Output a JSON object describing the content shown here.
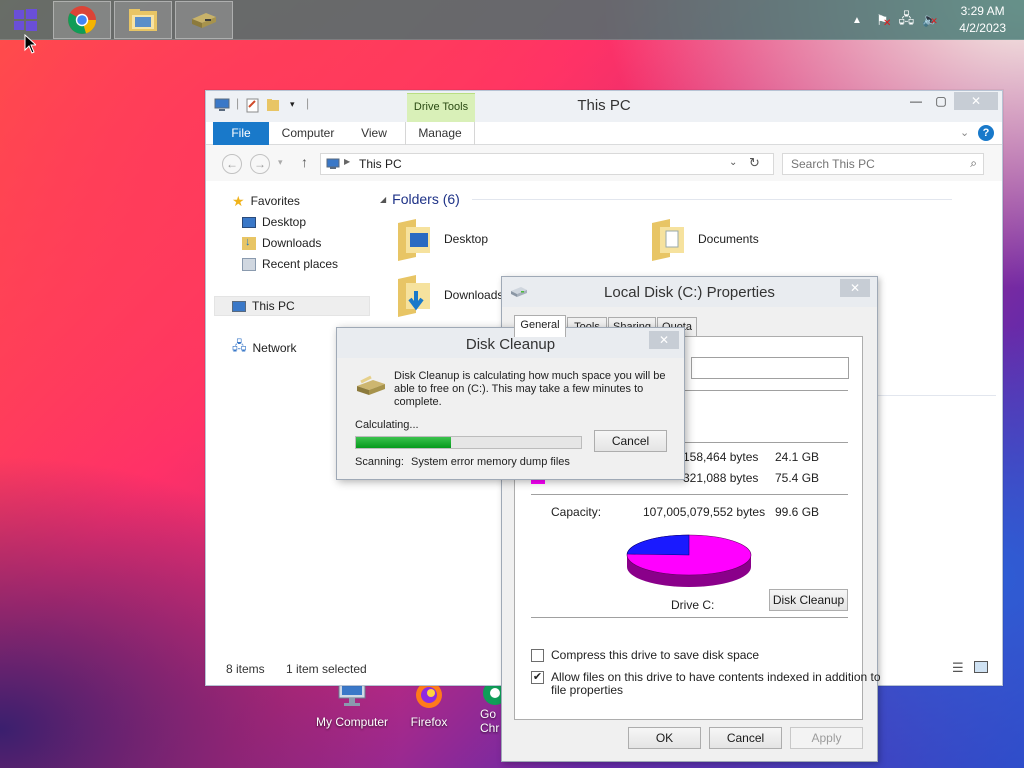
{
  "taskbar": {
    "apps": [
      "start-menu",
      "chrome",
      "file-explorer",
      "disk-drive"
    ],
    "clock": {
      "time": "3:29 AM",
      "date": "4/2/2023"
    }
  },
  "explorer": {
    "title": "This PC",
    "contextual_tab": "Drive Tools",
    "ribbon_tabs": [
      "File",
      "Computer",
      "View",
      "Manage"
    ],
    "address": "This PC",
    "search_placeholder": "Search This PC",
    "nav": {
      "favorites": "Favorites",
      "desktop": "Desktop",
      "downloads": "Downloads",
      "recent": "Recent places",
      "this_pc": "This PC",
      "network": "Network"
    },
    "folders_header": "Folders (6)",
    "folders": [
      "Desktop",
      "Documents",
      "Downloads"
    ],
    "status": {
      "items": "8 items",
      "selected": "1 item selected"
    }
  },
  "properties": {
    "title": "Local Disk (C:) Properties",
    "tabs": [
      "General",
      "Tools",
      "Sharing",
      "Quota"
    ],
    "used_bytes": "158,464 bytes",
    "used_gb": "24.1 GB",
    "free_bytes": "321,088 bytes",
    "free_gb": "75.4 GB",
    "capacity_label": "Capacity:",
    "capacity_bytes": "107,005,079,552 bytes",
    "capacity_gb": "99.6 GB",
    "drive_label": "Drive C:",
    "cleanup_button": "Disk Cleanup",
    "compress_label": "Compress this drive to save disk space",
    "compress_checked": false,
    "index_label_1": "Allow files on this drive to have contents indexed in addition to",
    "index_label_2": "file properties",
    "index_checked": true,
    "ok": "OK",
    "cancel": "Cancel",
    "apply": "Apply",
    "colors": {
      "used": "#1a1aff",
      "free": "#ff00ff"
    },
    "used_fraction": 0.242
  },
  "cleanup": {
    "title": "Disk Cleanup",
    "message_1": "Disk Cleanup is calculating how much space you will be",
    "message_2": "able to free on  (C:). This may take a few minutes to",
    "message_3": "complete.",
    "calculating": "Calculating...",
    "cancel": "Cancel",
    "scanning_label": "Scanning:",
    "scanning_item": "System error memory dump files",
    "progress": 0.42
  },
  "desktop_icons": [
    "My Computer",
    "Firefox",
    "Go",
    "Chr"
  ]
}
